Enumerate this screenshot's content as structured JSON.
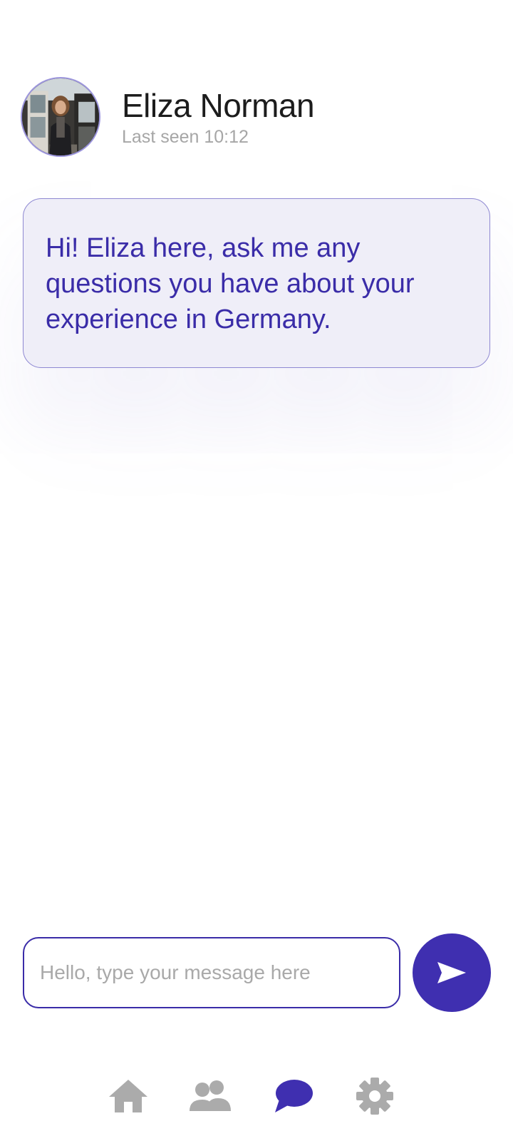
{
  "header": {
    "contact_name": "Eliza Norman",
    "last_seen": "Last seen 10:12"
  },
  "messages": [
    {
      "sender": "Eliza Norman",
      "text": "Hi! Eliza here, ask me any questions you have about your experience in Germany."
    }
  ],
  "composer": {
    "value": "",
    "placeholder": "Hello, type your message here",
    "send_icon": "send-icon"
  },
  "nav": {
    "items": [
      {
        "icon": "home-icon",
        "active": false
      },
      {
        "icon": "people-icon",
        "active": false
      },
      {
        "icon": "chat-icon",
        "active": true
      },
      {
        "icon": "gear-icon",
        "active": false
      }
    ]
  },
  "colors": {
    "accent": "#3f2fb0",
    "bubble_background": "#efeef8",
    "bubble_text": "#3a2ca8",
    "inactive_icon": "#ababab",
    "secondary_text": "#a6a6a6"
  }
}
